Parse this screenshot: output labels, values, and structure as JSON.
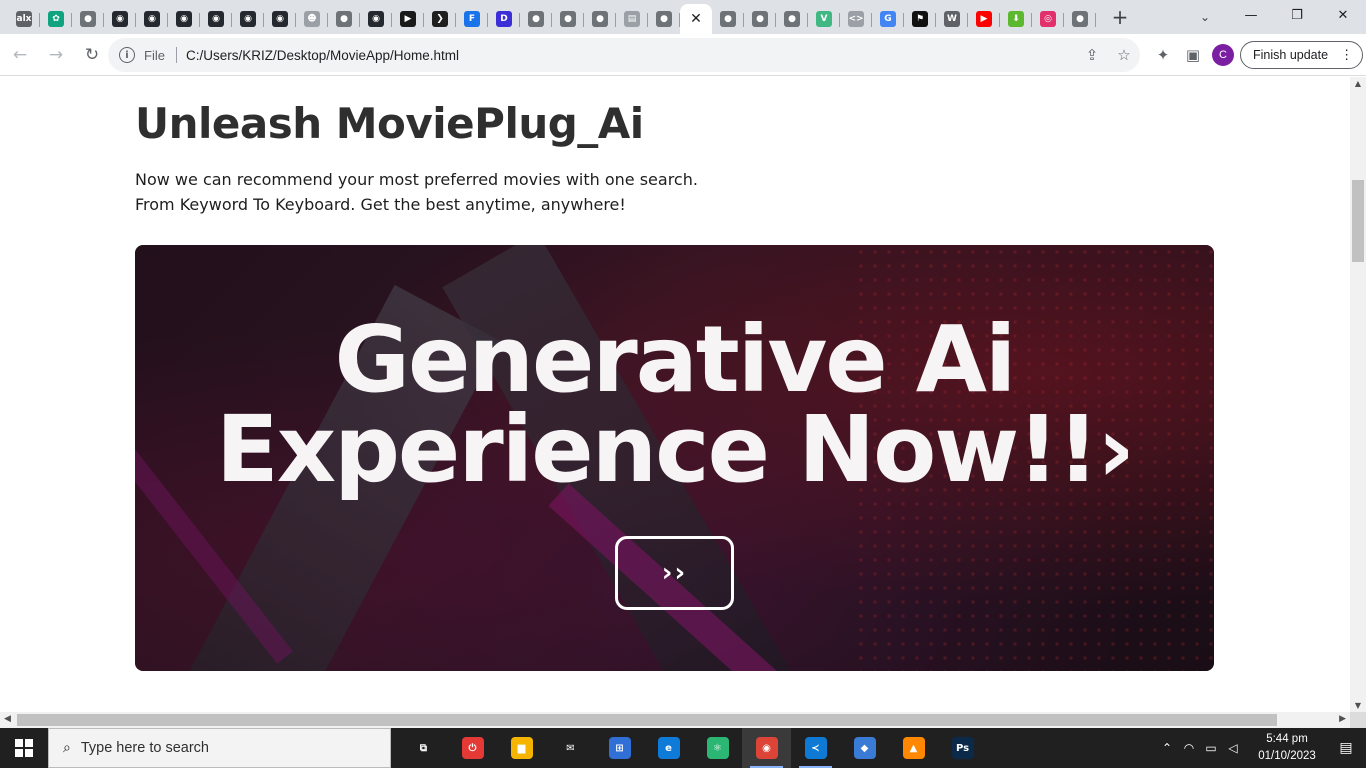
{
  "browser": {
    "tabs": [
      {
        "icon": "alx-icon",
        "glyph": "alx",
        "color": "#5f6368"
      },
      {
        "icon": "chatgpt-icon",
        "glyph": "✿",
        "color": "#10a37f"
      },
      {
        "icon": "globe-icon",
        "glyph": "●",
        "color": "#6e7378"
      },
      {
        "icon": "github-icon",
        "glyph": "◉",
        "color": "#24292f"
      },
      {
        "icon": "github-icon",
        "glyph": "◉",
        "color": "#24292f"
      },
      {
        "icon": "github-icon",
        "glyph": "◉",
        "color": "#24292f"
      },
      {
        "icon": "github-icon",
        "glyph": "◉",
        "color": "#24292f"
      },
      {
        "icon": "github-icon",
        "glyph": "◉",
        "color": "#24292f"
      },
      {
        "icon": "github-icon",
        "glyph": "◉",
        "color": "#24292f"
      },
      {
        "icon": "reddit-icon",
        "glyph": "☻",
        "color": "#9aa0a6"
      },
      {
        "icon": "globe-icon",
        "glyph": "●",
        "color": "#6e7378"
      },
      {
        "icon": "github-icon",
        "glyph": "◉",
        "color": "#24292f"
      },
      {
        "icon": "play-icon",
        "glyph": "▶",
        "color": "#1a1a1a"
      },
      {
        "icon": "plex-icon",
        "glyph": "❯",
        "color": "#1f1f1f"
      },
      {
        "icon": "flag-icon",
        "glyph": "F",
        "color": "#1a73e8"
      },
      {
        "icon": "brand-icon",
        "glyph": "D",
        "color": "#3d2fd8"
      },
      {
        "icon": "globe-icon",
        "glyph": "●",
        "color": "#6e7378"
      },
      {
        "icon": "globe-icon",
        "glyph": "●",
        "color": "#6e7378"
      },
      {
        "icon": "globe-icon",
        "glyph": "●",
        "color": "#6e7378"
      },
      {
        "icon": "doc-icon",
        "glyph": "▤",
        "color": "#9aa0a6"
      },
      {
        "icon": "globe-icon",
        "glyph": "●",
        "color": "#6e7378"
      },
      {
        "icon": "globe-icon",
        "glyph": "●",
        "color": "#6e7378"
      },
      {
        "icon": "globe-icon",
        "glyph": "●",
        "color": "#6e7378"
      },
      {
        "icon": "globe-icon",
        "glyph": "●",
        "color": "#6e7378"
      },
      {
        "icon": "vue-icon",
        "glyph": "V",
        "color": "#41b883"
      },
      {
        "icon": "code-icon",
        "glyph": "<>",
        "color": "#9aa0a6"
      },
      {
        "icon": "google-icon",
        "glyph": "G",
        "color": "#4285f4"
      },
      {
        "icon": "flag-icon",
        "glyph": "⚑",
        "color": "#111111"
      },
      {
        "icon": "wikipedia-icon",
        "glyph": "W",
        "color": "#5f6368"
      },
      {
        "icon": "youtube-icon",
        "glyph": "▶",
        "color": "#ff0000"
      },
      {
        "icon": "download-icon",
        "glyph": "⬇",
        "color": "#5cb82e"
      },
      {
        "icon": "instagram-icon",
        "glyph": "◎",
        "color": "#e1306c"
      },
      {
        "icon": "globe-icon",
        "glyph": "●",
        "color": "#6e7378"
      }
    ],
    "active_tab_index": 20,
    "close_glyph": "✕",
    "new_tab_glyph": "+",
    "tab_search_glyph": "⌄",
    "window_controls": {
      "minimize": "—",
      "restore": "❐",
      "close": "✕"
    },
    "nav": {
      "back": "←",
      "forward": "→",
      "reload": "↻"
    },
    "address": {
      "info_glyph": "i",
      "scheme_label": "File",
      "url": "C:/Users/KRIZ/Desktop/MovieApp/Home.html",
      "share_glyph": "⇪",
      "star_glyph": "☆"
    },
    "toolbar_right": {
      "extensions_glyph": "✦",
      "sidepanel_glyph": "▣",
      "avatar_letter": "C",
      "update_label": "Finish update",
      "menu_glyph": "⋮"
    }
  },
  "page": {
    "headline": "Unleash MoviePlug_Ai",
    "subtext_line1": "Now we can recommend your most preferred movies with one search.",
    "subtext_line2": "From Keyword To Keyboard. Get the best anytime, anywhere!",
    "hero": {
      "title_line1": "Generative Ai",
      "title_line2": "Experience Now!!›",
      "button_label": "››"
    }
  },
  "taskbar": {
    "search_placeholder": "Type here to search",
    "search_glyph": "⌕",
    "apps": [
      {
        "icon": "task-view-icon",
        "glyph": "⧉",
        "bg": "transparent",
        "running": false,
        "active": false
      },
      {
        "icon": "power-app-icon",
        "glyph": "⏻",
        "bg": "#e53935",
        "running": false,
        "active": false
      },
      {
        "icon": "file-explorer-icon",
        "glyph": "▆",
        "bg": "#f4b400",
        "running": false,
        "active": false
      },
      {
        "icon": "mail-icon",
        "glyph": "✉",
        "bg": "transparent",
        "running": false,
        "active": false
      },
      {
        "icon": "store-icon",
        "glyph": "⊞",
        "bg": "#2f6fd6",
        "running": false,
        "active": false
      },
      {
        "icon": "edge-icon",
        "glyph": "e",
        "bg": "#0f7bd9",
        "running": false,
        "active": false
      },
      {
        "icon": "atom-icon",
        "glyph": "⚛",
        "bg": "#2bb673",
        "running": false,
        "active": false
      },
      {
        "icon": "chrome-icon",
        "glyph": "◉",
        "bg": "#db4437",
        "running": true,
        "active": true
      },
      {
        "icon": "vscode-icon",
        "glyph": "≺",
        "bg": "#0e7ad3",
        "running": true,
        "active": false
      },
      {
        "icon": "git-icon",
        "glyph": "◆",
        "bg": "#3a7bd5",
        "running": false,
        "active": false
      },
      {
        "icon": "vlc-icon",
        "glyph": "▲",
        "bg": "#ff8800",
        "running": false,
        "active": false
      },
      {
        "icon": "photoshop-icon",
        "glyph": "Ps",
        "bg": "#0b2a4a",
        "running": false,
        "active": false
      }
    ],
    "tray": {
      "chevron": "⌃",
      "network": "◠",
      "battery": "▭",
      "volume": "◁"
    },
    "time": "5:44 pm",
    "date": "01/10/2023",
    "notification_glyph": "▤"
  }
}
